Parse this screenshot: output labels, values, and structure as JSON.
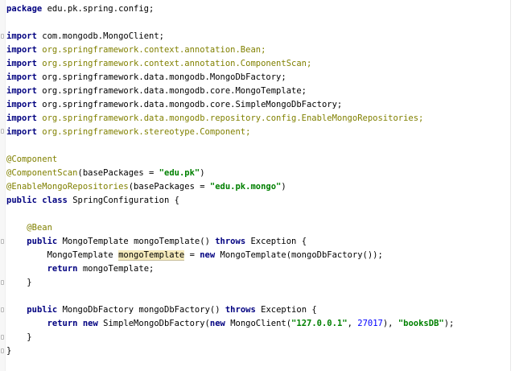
{
  "editor": {
    "lines": [
      [
        [
          "kw",
          "package"
        ],
        [
          "",
          "edu.pk.spring.config;"
        ]
      ],
      [],
      [
        [
          "kw",
          "import"
        ],
        [
          "",
          "com.mongodb.MongoClient;"
        ]
      ],
      [
        [
          "kw",
          "import"
        ],
        [
          "gray",
          "org.springframework.context.annotation.Bean;"
        ]
      ],
      [
        [
          "kw",
          "import"
        ],
        [
          "gray",
          "org.springframework.context.annotation.ComponentScan;"
        ]
      ],
      [
        [
          "kw",
          "import"
        ],
        [
          "",
          "org.springframework.data.mongodb.MongoDbFactory;"
        ]
      ],
      [
        [
          "kw",
          "import"
        ],
        [
          "",
          "org.springframework.data.mongodb.core.MongoTemplate;"
        ]
      ],
      [
        [
          "kw",
          "import"
        ],
        [
          "",
          "org.springframework.data.mongodb.core.SimpleMongoDbFactory;"
        ]
      ],
      [
        [
          "kw",
          "import"
        ],
        [
          "gray",
          "org.springframework.data.mongodb.repository.config.EnableMongoRepositories;"
        ]
      ],
      [
        [
          "kw",
          "import"
        ],
        [
          "gray",
          "org.springframework.stereotype.Component;"
        ]
      ],
      [],
      [
        [
          "ann",
          "@Component"
        ]
      ],
      [
        [
          "ann",
          "@ComponentScan"
        ],
        [
          "",
          "(basePackages = "
        ],
        [
          "str",
          "\"edu.pk\""
        ],
        [
          "",
          ")"
        ]
      ],
      [
        [
          "ann",
          "@EnableMongoRepositories"
        ],
        [
          "",
          "(basePackages = "
        ],
        [
          "str",
          "\"edu.pk.mongo\""
        ],
        [
          "",
          ")"
        ]
      ],
      [
        [
          "kw",
          "public class "
        ],
        [
          "",
          "SpringConfiguration {"
        ]
      ],
      [],
      [
        [
          "",
          "    "
        ],
        [
          "ann",
          "@Bean"
        ]
      ],
      [
        [
          "",
          "    "
        ],
        [
          "kw",
          "public "
        ],
        [
          "",
          "MongoTemplate mongoTemplate() "
        ],
        [
          "kw",
          "throws "
        ],
        [
          "",
          "Exception {"
        ]
      ],
      [
        [
          "",
          "        MongoTemplate "
        ],
        [
          "hl",
          "mongoTemplate"
        ],
        [
          "",
          " = "
        ],
        [
          "kw",
          "new "
        ],
        [
          "",
          "MongoTemplate(mongoDbFactory());"
        ]
      ],
      [
        [
          "",
          "        "
        ],
        [
          "kw",
          "return "
        ],
        [
          "",
          "mongoTemplate;"
        ]
      ],
      [
        [
          "",
          "    }"
        ]
      ],
      [],
      [
        [
          "",
          "    "
        ],
        [
          "kw",
          "public "
        ],
        [
          "",
          "MongoDbFactory mongoDbFactory() "
        ],
        [
          "kw",
          "throws "
        ],
        [
          "",
          "Exception {"
        ]
      ],
      [
        [
          "",
          "        "
        ],
        [
          "kw",
          "return new "
        ],
        [
          "",
          "SimpleMongoDbFactory("
        ],
        [
          "kw",
          "new "
        ],
        [
          "",
          "MongoClient("
        ],
        [
          "str",
          "\"127.0.0.1\""
        ],
        [
          "",
          ", "
        ],
        [
          "num",
          "27017"
        ],
        [
          "",
          "), "
        ],
        [
          "str",
          "\"booksDB\""
        ],
        [
          "",
          ");"
        ]
      ],
      [
        [
          "",
          "    }"
        ]
      ],
      [
        [
          "",
          "}"
        ]
      ]
    ]
  }
}
